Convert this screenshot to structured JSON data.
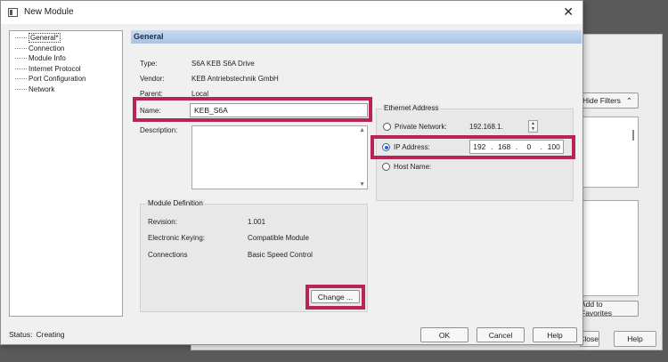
{
  "window": {
    "title": "New Module",
    "close_glyph": "✕"
  },
  "tree": {
    "items": [
      {
        "label": "General*",
        "selected": true
      },
      {
        "label": "Connection"
      },
      {
        "label": "Module Info"
      },
      {
        "label": "Internet Protocol"
      },
      {
        "label": "Port Configuration"
      },
      {
        "label": "Network"
      }
    ]
  },
  "general": {
    "header": "General",
    "type_label": "Type:",
    "type_value": "S6A KEB S6A Drive",
    "vendor_label": "Vendor:",
    "vendor_value": "KEB Antriebstechnik GmbH",
    "parent_label": "Parent:",
    "parent_value": "Local",
    "name_label": "Name:",
    "name_value": "KEB_S6A",
    "description_label": "Description:",
    "description_value": ""
  },
  "module_definition": {
    "title": "Module Definition",
    "revision_label": "Revision:",
    "revision_value": "1.001",
    "keying_label": "Electronic Keying:",
    "keying_value": "Compatible Module",
    "connections_label": "Connections",
    "connections_value": "Basic Speed Control",
    "change_button": "Change ..."
  },
  "ethernet": {
    "title": "Ethernet Address",
    "private_label": "Private Network:",
    "private_value": "192.168.1.",
    "ip_label": "IP Address:",
    "ip_octets": [
      "192",
      "168",
      "0",
      "100"
    ],
    "host_label": "Host Name:",
    "selected": "ip"
  },
  "footer": {
    "status_label": "Status:",
    "status_value": "Creating",
    "ok": "OK",
    "cancel": "Cancel",
    "help": "Help"
  },
  "background_dialog": {
    "hide_filters": "Hide Filters",
    "hide_filters_glyph": "⌃",
    "add_favorites": "Add to Favorites",
    "close": "Close",
    "help": "Help"
  },
  "colors": {
    "highlight": "#b8245a",
    "header_blue": "#b8cfea"
  }
}
